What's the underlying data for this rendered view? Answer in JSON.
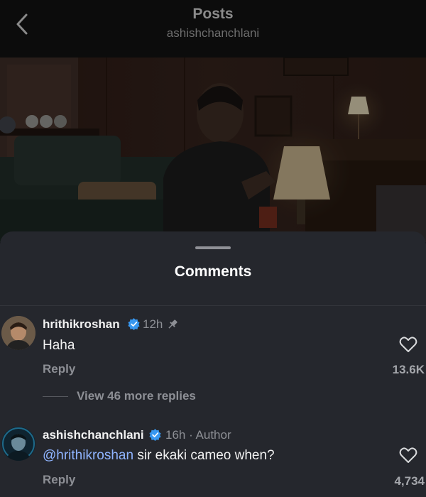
{
  "header": {
    "title": "Posts",
    "subtitle": "ashishchanchlani"
  },
  "sheet": {
    "title": "Comments"
  },
  "comments": [
    {
      "username": "hrithikroshan",
      "verified": true,
      "time": "12h",
      "pinned": true,
      "text": "Haha",
      "reply_label": "Reply",
      "likes": "13.6K",
      "view_replies": "View 46 more replies"
    },
    {
      "username": "ashishchanchlani",
      "verified": true,
      "time": "16h · Author",
      "mention": "@hrithikroshan",
      "text": " sir ekaki cameo when?",
      "reply_label": "Reply",
      "likes": "4,734"
    }
  ],
  "colors": {
    "verified": "#3797f0",
    "mention": "#8fb4ff",
    "sheet_bg": "#25272d"
  }
}
